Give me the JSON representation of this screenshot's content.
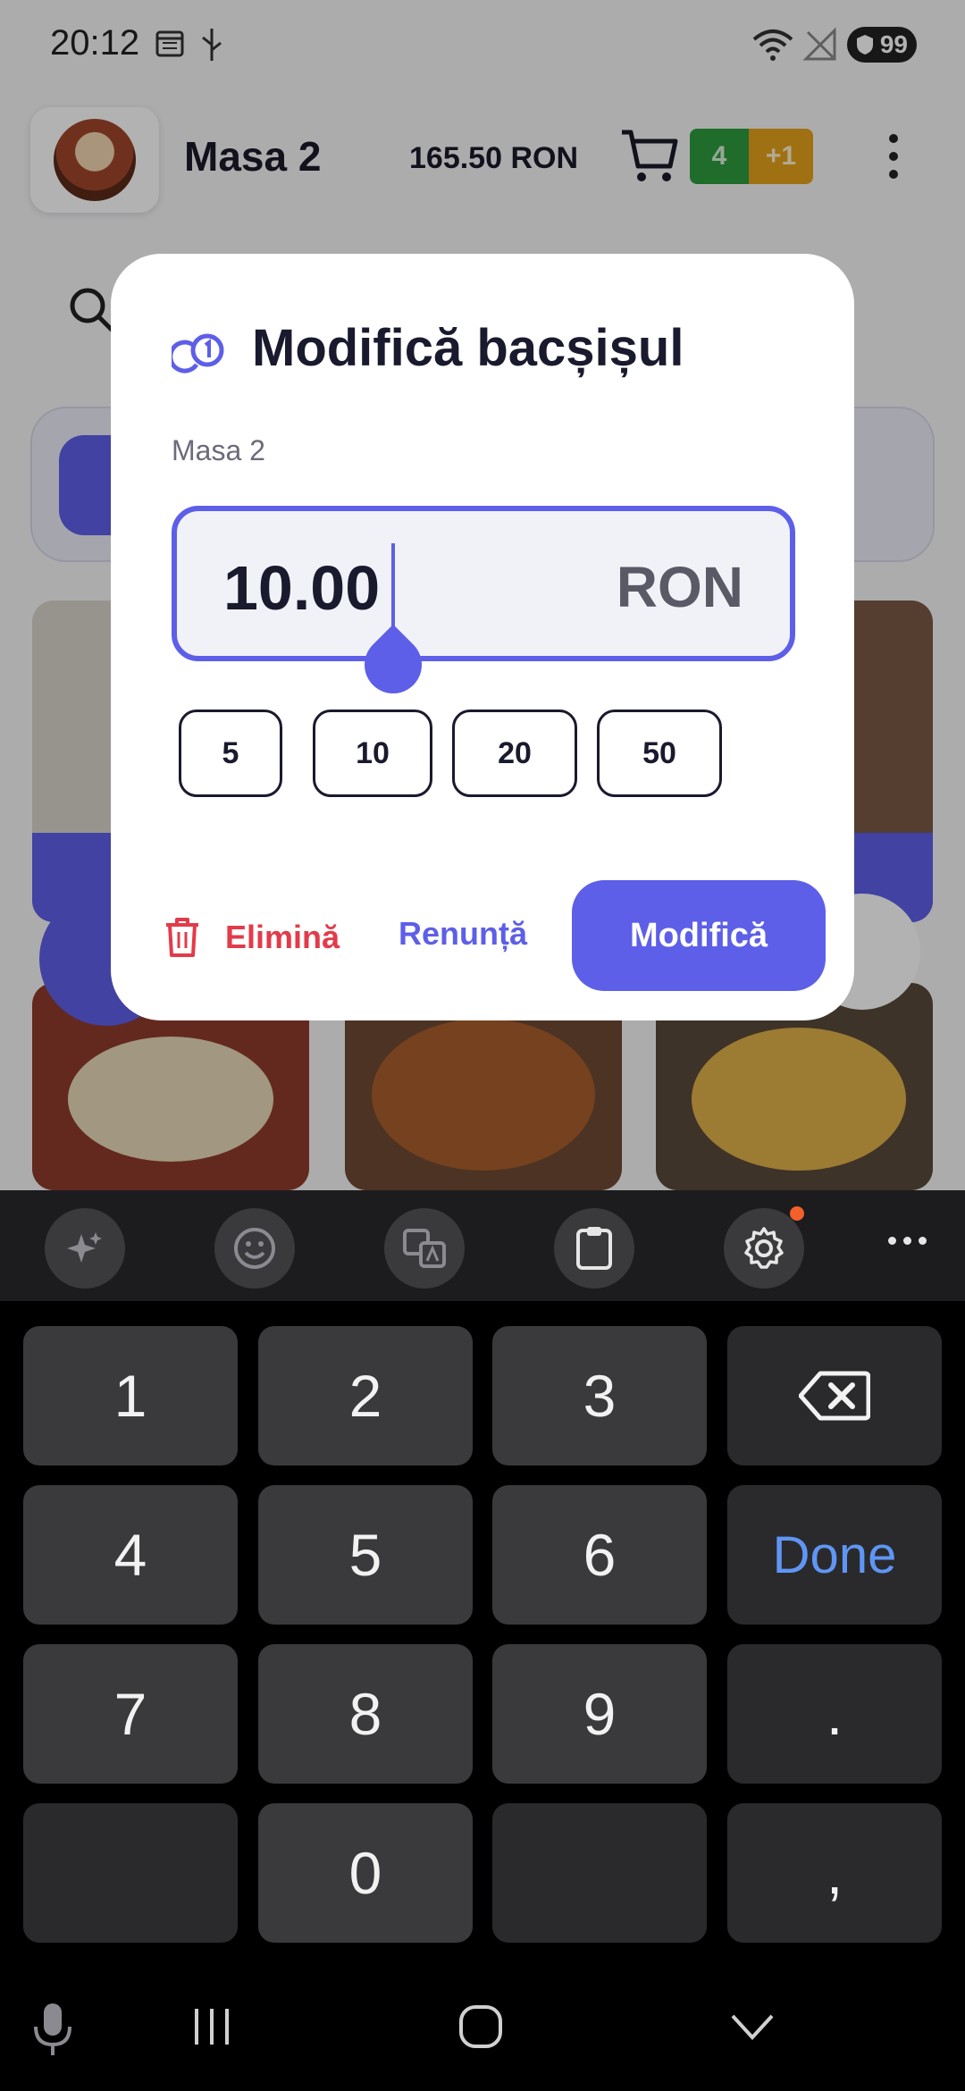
{
  "status_bar": {
    "time": "20:12",
    "battery": "99"
  },
  "header": {
    "table_name": "Masa 2",
    "total": "165.50 RON",
    "cart_count": "4",
    "cart_extra": "+1"
  },
  "dialog": {
    "title": "Modifică bacșișul",
    "subtitle": "Masa 2",
    "amount_value": "10.00",
    "currency": "RON",
    "quick_amounts": [
      "5",
      "10",
      "20",
      "50"
    ],
    "delete_label": "Elimină",
    "cancel_label": "Renunță",
    "confirm_label": "Modifică"
  },
  "keyboard": {
    "rows": [
      [
        "1",
        "2",
        "3",
        "⌫"
      ],
      [
        "4",
        "5",
        "6",
        "Done"
      ],
      [
        "7",
        "8",
        "9",
        "."
      ],
      [
        "",
        "0",
        "",
        ","
      ]
    ]
  },
  "icons": {
    "status": [
      "calendar-icon",
      "usb-icon",
      "wifi-icon",
      "no-signal-icon"
    ],
    "toolbar": [
      "ai-sparkle-icon",
      "emoji-icon",
      "translate-icon",
      "clipboard-icon",
      "settings-icon",
      "more-icon"
    ],
    "nav": [
      "mic-icon",
      "recent-apps-icon",
      "home-icon",
      "hide-keyboard-icon"
    ]
  },
  "colors": {
    "accent": "#5d5fe8",
    "danger": "#e23b4a",
    "badge_green": "#2e9b3e",
    "badge_orange": "#e5a31c",
    "done_key": "#5f96f5"
  }
}
